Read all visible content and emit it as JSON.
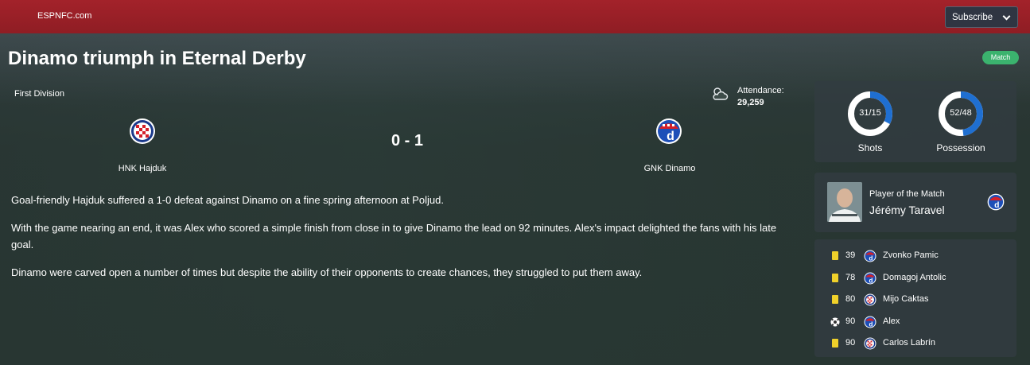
{
  "header": {
    "brand": "ESPNFC.com",
    "subscribe_label": "Subscribe",
    "brand_color": "#9c2028"
  },
  "article": {
    "headline": "Dinamo triumph in Eternal Derby",
    "tag": "Match",
    "tag_color": "#3bb36e",
    "paragraphs": [
      "Goal-friendly Hajduk suffered a 1-0 defeat against Dinamo on a fine spring afternoon at Poljud.",
      "With the game nearing an end, it was Alex who scored a simple finish from close in to give Dinamo the lead on 92 minutes. Alex's impact delighted the fans with his late goal.",
      "Dinamo were carved open a number of times but despite the ability of their opponents to create chances, they struggled to put them away."
    ]
  },
  "match": {
    "competition": "First Division",
    "weather_icon": "cloudy-icon",
    "attendance_label": "Attendance:",
    "attendance_value": "29,259",
    "score": "0 - 1",
    "home_team": "HNK Hajduk",
    "away_team": "GNK Dinamo"
  },
  "stats": {
    "shots": {
      "text": "31/15",
      "label": "Shots",
      "home": 31,
      "away": 15
    },
    "possession": {
      "text": "52/48",
      "label": "Possession",
      "home": 52,
      "away": 48
    },
    "home_color": "#ffffff",
    "away_color": "#1f6fd1"
  },
  "potm": {
    "label": "Player of the Match",
    "name": "Jérémy Taravel",
    "club_icon": "dinamo-crest-icon"
  },
  "events": [
    {
      "icon": "yellow-card-icon",
      "minute": "39",
      "team": "dinamo",
      "player": "Zvonko Pamic"
    },
    {
      "icon": "yellow-card-icon",
      "minute": "78",
      "team": "dinamo",
      "player": "Domagoj Antolic"
    },
    {
      "icon": "yellow-card-icon",
      "minute": "80",
      "team": "hajduk",
      "player": "Mijo Caktas"
    },
    {
      "icon": "goal-ball-icon",
      "minute": "90",
      "team": "dinamo",
      "player": "Alex"
    },
    {
      "icon": "yellow-card-icon",
      "minute": "90",
      "team": "hajduk",
      "player": "Carlos Labrín"
    }
  ]
}
